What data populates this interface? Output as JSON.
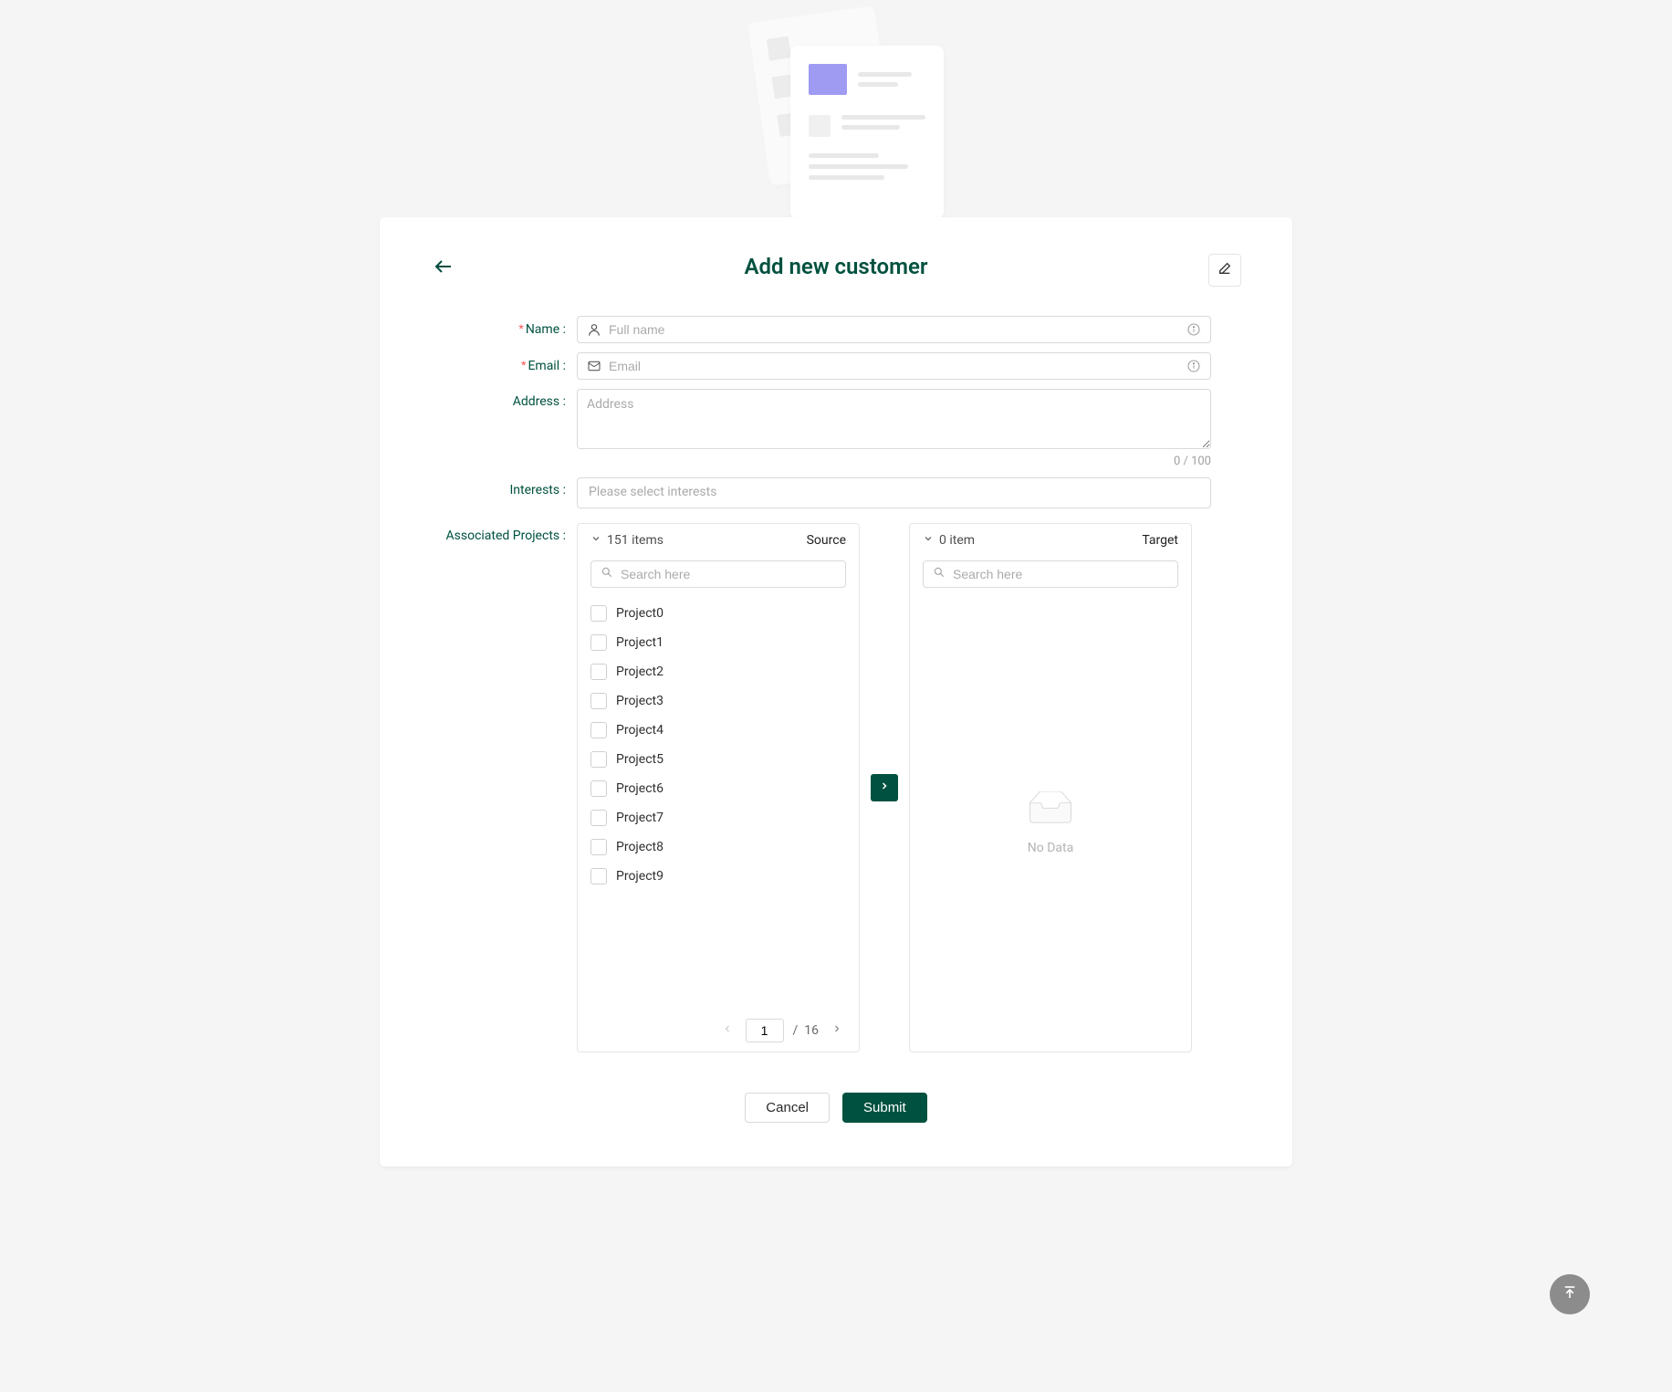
{
  "title": "Add new customer",
  "fields": {
    "name": {
      "label": "Name",
      "placeholder": "Full name",
      "value": ""
    },
    "email": {
      "label": "Email",
      "placeholder": "Email",
      "value": ""
    },
    "address": {
      "label": "Address",
      "placeholder": "Address",
      "value": "",
      "counter": "0 / 100"
    },
    "interests": {
      "label": "Interests",
      "placeholder": "Please select interests"
    },
    "projects": {
      "label": "Associated Projects"
    }
  },
  "transfer": {
    "source": {
      "countLabel": "151 items",
      "title": "Source",
      "searchPlaceholder": "Search here",
      "items": [
        "Project0",
        "Project1",
        "Project2",
        "Project3",
        "Project4",
        "Project5",
        "Project6",
        "Project7",
        "Project8",
        "Project9"
      ],
      "page": "1",
      "totalPages": "16"
    },
    "target": {
      "countLabel": "0 item",
      "title": "Target",
      "searchPlaceholder": "Search here",
      "emptyText": "No Data"
    }
  },
  "actions": {
    "cancel": "Cancel",
    "submit": "Submit"
  },
  "colors": {
    "primary": "#00513f"
  }
}
